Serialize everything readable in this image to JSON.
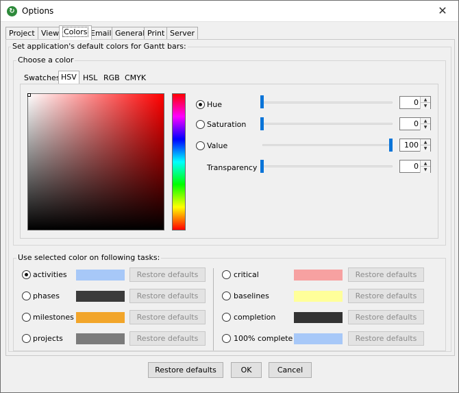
{
  "window": {
    "title": "Options"
  },
  "tabs": [
    "Project",
    "View",
    "Colors",
    "Email",
    "General",
    "Print",
    "Server"
  ],
  "section_title": "Set application's default colors for Gantt bars:",
  "chooser": {
    "title": "Choose a color",
    "tabs": [
      "Swatches",
      "HSV",
      "HSL",
      "RGB",
      "CMYK"
    ],
    "hsv": {
      "hue": {
        "label": "Hue",
        "value": "0",
        "level": 0
      },
      "saturation": {
        "label": "Saturation",
        "value": "0",
        "level": 0
      },
      "value": {
        "label": "Value",
        "value": "100",
        "level": 1
      },
      "transparency": {
        "label": "Transparency",
        "value": "0",
        "level": 0
      }
    }
  },
  "tasks_title": "Use selected color on following tasks:",
  "tasks_left": [
    {
      "label": "activities",
      "color": "#a7c8f8",
      "checked": true
    },
    {
      "label": "phases",
      "color": "#3b3b3b",
      "checked": false
    },
    {
      "label": "milestones",
      "color": "#f2a52a",
      "checked": false
    },
    {
      "label": "projects",
      "color": "#7b7b7b",
      "checked": false
    }
  ],
  "tasks_right": [
    {
      "label": "critical",
      "color": "#f7a1a1",
      "checked": false
    },
    {
      "label": "baselines",
      "color": "#ffff9a",
      "checked": false
    },
    {
      "label": "completion",
      "color": "#333333",
      "checked": false
    },
    {
      "label": "100% complete",
      "color": "#a7c8f8",
      "checked": false
    }
  ],
  "restore_label": "Restore defaults",
  "footer": {
    "restore": "Restore defaults",
    "ok": "OK",
    "cancel": "Cancel"
  }
}
